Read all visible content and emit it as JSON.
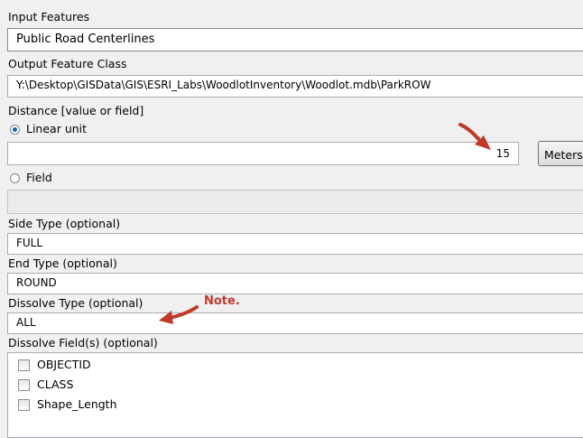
{
  "input_features": {
    "label": "Input Features",
    "value": "Public Road Centerlines"
  },
  "output_feature_class": {
    "label": "Output Feature Class",
    "value": "Y:\\Desktop\\GISData\\GIS\\ESRI_Labs\\WoodlotInventory\\Woodlot.mdb\\ParkROW"
  },
  "distance": {
    "label": "Distance [value or field]",
    "linear_unit_label": "Linear unit",
    "linear_unit_value": "15",
    "unit_button": "Meters",
    "field_label": "Field",
    "field_value": ""
  },
  "side_type": {
    "label": "Side Type (optional)",
    "value": "FULL"
  },
  "end_type": {
    "label": "End Type (optional)",
    "value": "ROUND"
  },
  "dissolve_type": {
    "label": "Dissolve Type (optional)",
    "value": "ALL"
  },
  "dissolve_fields": {
    "label": "Dissolve Field(s) (optional)",
    "items": [
      "OBJECTID",
      "CLASS",
      "Shape_Length"
    ]
  },
  "annotation": {
    "note": "Note.",
    "color": "#c0392b"
  },
  "icons": {
    "arrow": "red-arrow-icon"
  }
}
